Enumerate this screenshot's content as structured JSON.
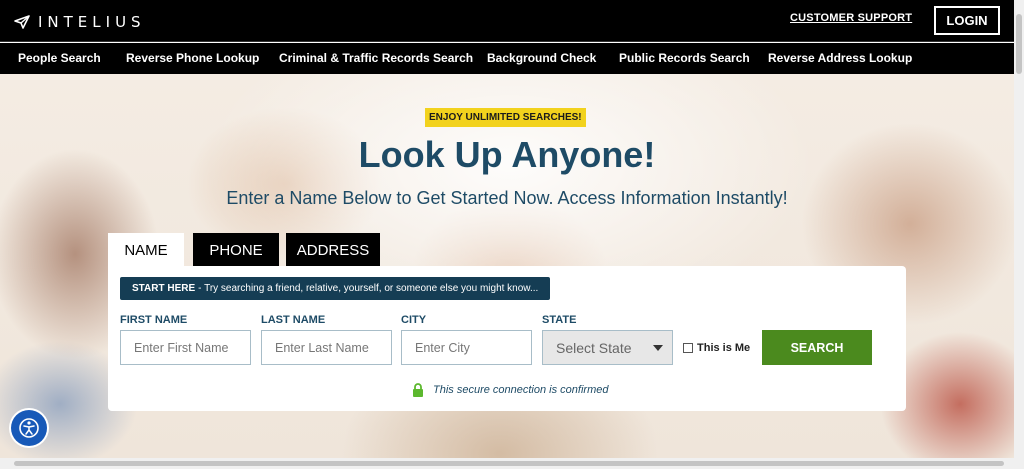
{
  "header": {
    "logo_text": "INTELIUS",
    "support_label": "CUSTOMER SUPPORT",
    "login_label": "LOGIN"
  },
  "nav": {
    "items": [
      "People Search",
      "Reverse Phone Lookup",
      "Criminal & Traffic Records Search",
      "Background Check",
      "Public Records Search",
      "Reverse Address Lookup"
    ]
  },
  "hero": {
    "badge": "ENJOY UNLIMITED SEARCHES!",
    "headline": "Look Up Anyone!",
    "subhead": "Enter a Name Below to Get Started Now. Access Information Instantly!"
  },
  "search": {
    "tabs": [
      "NAME",
      "PHONE",
      "ADDRESS"
    ],
    "active_tab": "NAME",
    "tip_strong": "START HERE",
    "tip_text": "- Try searching a friend, relative, yourself, or someone else you might know...",
    "fields": {
      "first_name": {
        "label": "FIRST NAME",
        "placeholder": "Enter First Name",
        "value": ""
      },
      "last_name": {
        "label": "LAST NAME",
        "placeholder": "Enter Last Name",
        "value": ""
      },
      "city": {
        "label": "CITY",
        "placeholder": "Enter City",
        "value": ""
      },
      "state": {
        "label": "STATE",
        "selected": "Select State"
      }
    },
    "this_is_me_label": "This is Me",
    "this_is_me_checked": false,
    "search_label": "SEARCH",
    "secure_text": "This secure connection is confirmed"
  },
  "colors": {
    "brand_navy": "#1e4b66",
    "search_green": "#4b8a1e",
    "badge_yellow": "#f2d21d",
    "a11y_blue": "#1759b8"
  },
  "icons": {
    "logo": "paper-plane-icon",
    "lock": "lock-icon",
    "accessibility": "accessibility-icon",
    "dropdown": "chevron-down-icon"
  }
}
